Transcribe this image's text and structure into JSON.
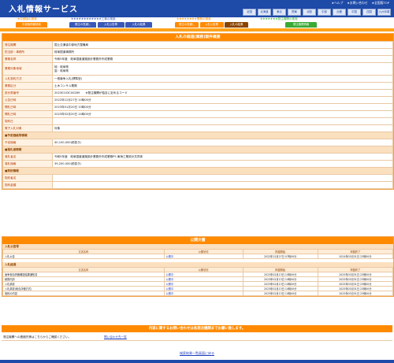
{
  "header": {
    "title": "入札情報サービス",
    "util": [
      "★ヘルプ",
      "★お問い合わせ",
      "★全国版TOP"
    ],
    "regions": [
      "全国",
      "北海道",
      "東北",
      "関東",
      "北陸",
      "中部",
      "近畿",
      "中国",
      "四国",
      "九州沖縄"
    ]
  },
  "menus": [
    {
      "label": "★中部版の検索",
      "color": "#ff8a00",
      "buttons": [
        "中部版情報検索"
      ]
    },
    {
      "label": "★★★★★★★★★★★★工事の検索",
      "color": "#3a58b6",
      "buttons": [
        "発注の見通し",
        "入札公告等",
        "入札の結果"
      ]
    },
    {
      "label": "★★★★★★★★業務の検索",
      "color": "#ff8a00",
      "buttons": [
        "発注の見通し",
        "入札公告等",
        "入札の結果"
      ]
    },
    {
      "label": "★★★★★★★発注機関の検索",
      "color": "#3aaa35",
      "buttons": [
        "発注機関情報"
      ]
    }
  ],
  "main": {
    "title": "入札の経過(業務)案件概要",
    "rows": [
      {
        "k": "発注機関",
        "v": "国土交通省中部地方整備局"
      },
      {
        "k": "担当部・事務所",
        "v": "岐阜国道事務所"
      },
      {
        "k": "業務名称",
        "v": "令和5年度　岐阜国道道路設計業務外作成業務"
      },
      {
        "k": "業務対象地域",
        "v": "岐：岐阜県\n富：岐阜県",
        "tall": true
      },
      {
        "k": "入札契約方式",
        "v": "一般競争入札(標準型)"
      },
      {
        "k": "業務区分",
        "v": "土木コンサル業務"
      },
      {
        "k": "設計書番号",
        "v": "20230103C00289　　※発注機関が独自に定めるコード"
      },
      {
        "k": "公告日時",
        "v": "2022年12月27日 10時00分"
      },
      {
        "k": "開札日時",
        "v": "2023年01月20日 10時00分"
      },
      {
        "k": "開札日時",
        "v": "2023年02月20日 14時00分"
      },
      {
        "k": "契約日",
        "v": ""
      },
      {
        "k": "電子入札対象",
        "v": "対象"
      }
    ],
    "sec1": "■予定価格等情報",
    "rows2": [
      {
        "k": "予定価格",
        "v": "40,100,000(税抜き)"
      }
    ],
    "sec2": "■落札者情報",
    "rows3": [
      {
        "k": "落札者名",
        "v": "令和5年度　岐阜国道道路設計業務外作成業務PS 東海工業設計共同体"
      },
      {
        "k": "落札価格",
        "v": "39,200,000(税抜き)"
      }
    ],
    "sec3": "■契約情報",
    "rows4": [
      {
        "k": "契約者名",
        "v": ""
      },
      {
        "k": "契約金額",
        "v": ""
      }
    ]
  },
  "pub": {
    "title": "公開文書",
    "cols": [
      "文書名称",
      "公開状況",
      "掲載開始",
      "掲載終了"
    ],
    "s1": "入札公告等",
    "t1": [
      [
        "入札公告",
        "公開中",
        "2022年12月27日 07時00分",
        "2024年03月31日 23時00分"
      ]
    ],
    "s2": "入札経過",
    "t2": [
      [
        "競争参加資格確認結果通知書",
        "公開中",
        "2023年02月13日 10時00分",
        "2025年03月31日 23時00分"
      ],
      [
        "積算内訳",
        "公開中",
        "2023年02月13日 10時00分",
        "2025年03月31日 23時00分"
      ],
      [
        "入札調書",
        "公開中",
        "2023年02月13日 10時00分",
        "2025年03月31日 23時00分"
      ],
      [
        "入札調書(総合評価方式)",
        "公開中",
        "2023年02月13日 10時00分",
        "2025年03月31日 23時00分"
      ],
      [
        "契約の内容",
        "公開中",
        "2023年02月13日 10時00分",
        "2025年03月31日 23時00分"
      ]
    ]
  },
  "contact": {
    "bar": "内容に関するお問い合わせは各発注機関までお願い致します。",
    "text": "発注機関への連絡先等はこちらからご確認ください。",
    "link": "問い合わせ先一覧"
  },
  "back": "検索結果一覧画面に戻る"
}
